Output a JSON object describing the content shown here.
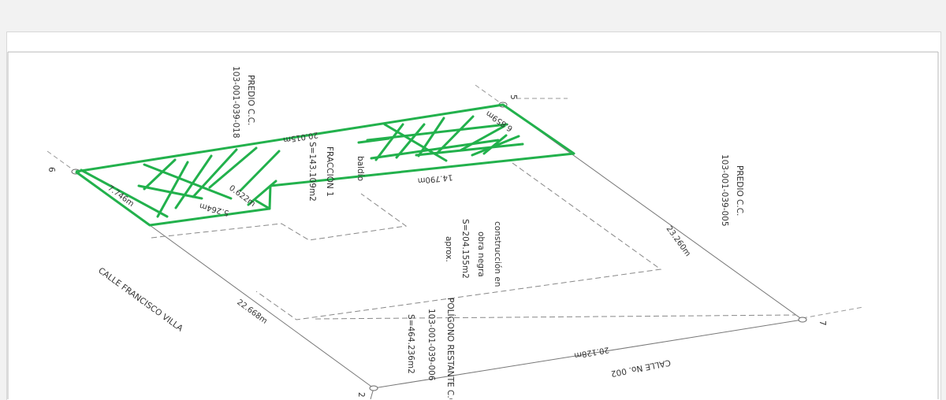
{
  "colors": {
    "highlight": "#22b14c",
    "line": "#666666",
    "text": "#333333"
  },
  "vertices": {
    "v5": "5",
    "v6": "6",
    "v7": "7",
    "v2": "2"
  },
  "neighbors": {
    "predio_left": {
      "line1": "PREDIO C.C.",
      "line2": "103-001-039-018"
    },
    "predio_right": {
      "line1": "PREDIO C.C.",
      "line2": "103-001-039-005"
    }
  },
  "streets": {
    "francisco_villa": "CALLE FRANCISCO VILLA",
    "calle_002": "CALLE No. 002"
  },
  "measures": {
    "top_edge": "20.015m",
    "right_short": "6.859m",
    "inner_long": "14.790m",
    "left_short": "7.746m",
    "notch_a": "0.622m",
    "notch_b": "5.264m",
    "right_long": "23.260m",
    "left_long": "22.668m",
    "bottom": "20.128m"
  },
  "fraccion": {
    "line1": "baldío",
    "line2": "FRACCIÓN 1",
    "line3": "S=143.109m2"
  },
  "construccion": {
    "line1": "construcción en",
    "line2": "obra negra",
    "line3": "S=204.155m2",
    "line4": "aprox."
  },
  "restante": {
    "line1": "POLÍGONO RESTANTE C.C.",
    "line2": "103-001-039-006",
    "line3": "S=464.236m2"
  }
}
